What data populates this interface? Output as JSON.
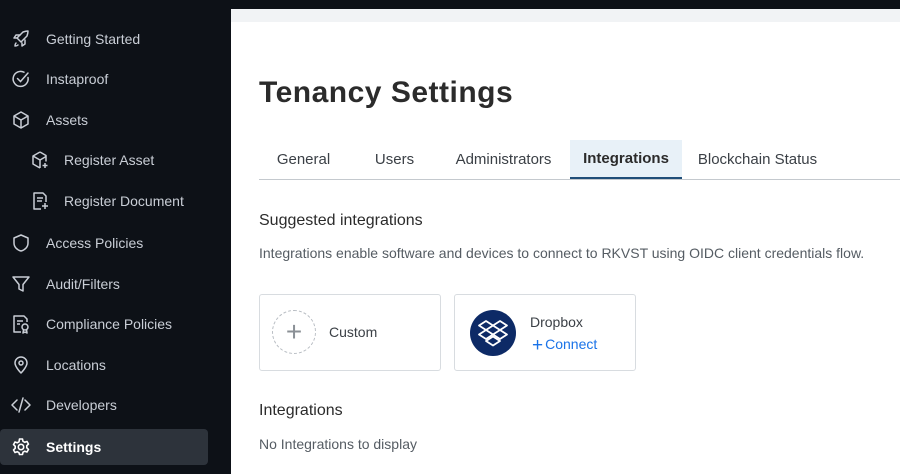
{
  "sidebar": {
    "items": [
      {
        "label": "Getting Started",
        "icon": "rocket-icon"
      },
      {
        "label": "Instaproof",
        "icon": "check-circle-icon"
      },
      {
        "label": "Assets",
        "icon": "cube-icon"
      },
      {
        "label": "Register Asset",
        "icon": "cube-plus-icon"
      },
      {
        "label": "Register Document",
        "icon": "document-plus-icon"
      },
      {
        "label": "Access Policies",
        "icon": "shield-icon"
      },
      {
        "label": "Audit/Filters",
        "icon": "filter-icon"
      },
      {
        "label": "Compliance Policies",
        "icon": "compliance-document-icon"
      },
      {
        "label": "Locations",
        "icon": "location-pin-icon"
      },
      {
        "label": "Developers",
        "icon": "code-icon"
      },
      {
        "label": "Settings",
        "icon": "gear-icon"
      }
    ],
    "active": "Settings"
  },
  "page": {
    "title": "Tenancy Settings",
    "tabs": [
      "General",
      "Users",
      "Administrators",
      "Integrations",
      "Blockchain Status"
    ],
    "active_tab": "Integrations"
  },
  "suggested": {
    "title": "Suggested integrations",
    "description": "Integrations enable software and devices to connect to RKVST using OIDC client credentials flow.",
    "custom_label": "Custom",
    "custom_icon": "plus-icon",
    "dropbox_label": "Dropbox",
    "dropbox_icon": "dropbox-logo-icon",
    "connect_label": "Connect"
  },
  "integrations": {
    "title": "Integrations",
    "empty_text": "No Integrations to display"
  },
  "colors": {
    "sidebar_bg": "#0d1117",
    "active_item_bg": "#2d333b",
    "accent": "#1f4e79",
    "link": "#1a73e8",
    "dropbox_bg": "#0d2a66"
  }
}
